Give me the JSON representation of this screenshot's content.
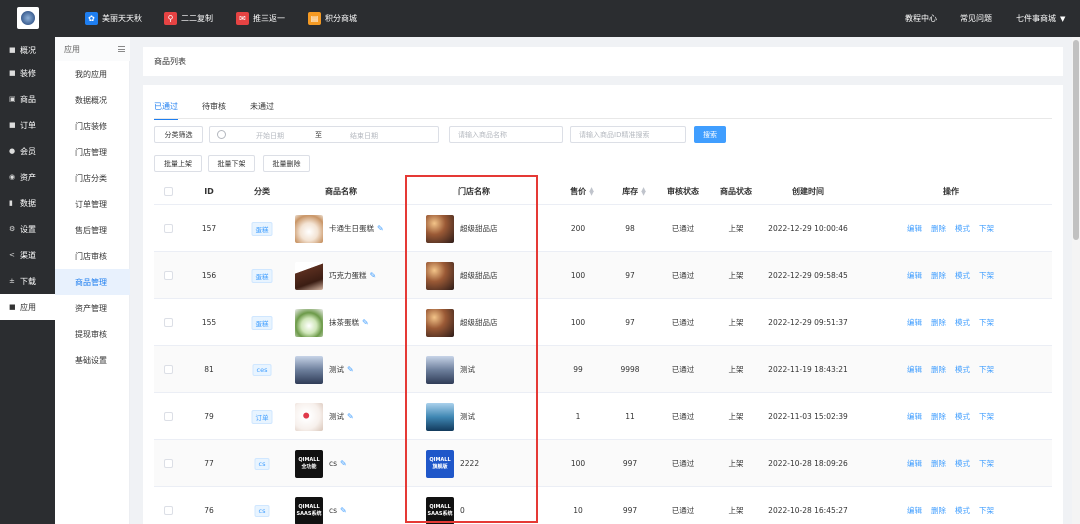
{
  "topbar": {
    "links": [
      {
        "label": "美丽天天秋",
        "icon": "gift-icon",
        "color": "#1e7ef0"
      },
      {
        "label": "二二复制",
        "icon": "share-icon",
        "color": "#e64343"
      },
      {
        "label": "推三返一",
        "icon": "redpacket-icon",
        "color": "#e64343"
      },
      {
        "label": "积分商城",
        "icon": "shop-icon",
        "color": "#f59a23"
      }
    ],
    "right": [
      "教程中心",
      "常见问题",
      "七件事商城"
    ]
  },
  "leftnav": [
    {
      "label": "概况",
      "icon": "square-icon"
    },
    {
      "label": "装修",
      "icon": "square-icon"
    },
    {
      "label": "商品",
      "icon": "cart-icon"
    },
    {
      "label": "订单",
      "icon": "order-icon"
    },
    {
      "label": "会员",
      "icon": "user-icon"
    },
    {
      "label": "资产",
      "icon": "asset-icon"
    },
    {
      "label": "数据",
      "icon": "chart-icon"
    },
    {
      "label": "设置",
      "icon": "gear-icon"
    },
    {
      "label": "渠道",
      "icon": "share-icon"
    },
    {
      "label": "下载",
      "icon": "download-icon"
    },
    {
      "label": "应用",
      "icon": "app-icon"
    }
  ],
  "subnav": {
    "title": "应用",
    "items": [
      "我的应用",
      "数据概况",
      "门店装修",
      "门店管理",
      "门店分类",
      "订单管理",
      "售后管理",
      "门店审核",
      "商品管理",
      "资产管理",
      "提现审核",
      "基础设置"
    ]
  },
  "breadcrumb": "商品列表",
  "tabs": [
    "已通过",
    "待审核",
    "未通过"
  ],
  "filters": {
    "category_btn": "分类筛选",
    "start_date": "开始日期",
    "to": "至",
    "end_date": "结束日期",
    "name_placeholder": "请输入商品名称",
    "id_placeholder": "请输入商品ID精准搜索",
    "search_btn": "搜索"
  },
  "batch": [
    "批量上架",
    "批量下架",
    "批量删除"
  ],
  "columns": {
    "id": "ID",
    "category": "分类",
    "name": "商品名称",
    "store": "门店名称",
    "price": "售价",
    "stock": "库存",
    "audit": "审核状态",
    "status": "商品状态",
    "created": "创建时间",
    "actions": "操作"
  },
  "actions": [
    "编辑",
    "删除",
    "模式",
    "下架"
  ],
  "rows": [
    {
      "id": "157",
      "category": "蛋糕",
      "name": "卡通生日蛋糕",
      "thumb": "cake",
      "store": "超级甜品店",
      "store_thumb": "store",
      "price": "200",
      "stock": "98",
      "audit": "已通过",
      "status": "上架",
      "created": "2022-12-29 10:00:46"
    },
    {
      "id": "156",
      "category": "蛋糕",
      "name": "巧克力蛋糕",
      "thumb": "choc",
      "store": "超级甜品店",
      "store_thumb": "store",
      "price": "100",
      "stock": "97",
      "audit": "已通过",
      "status": "上架",
      "created": "2022-12-29 09:58:45"
    },
    {
      "id": "155",
      "category": "蛋糕",
      "name": "抹茶蛋糕",
      "thumb": "matcha",
      "store": "超级甜品店",
      "store_thumb": "store",
      "price": "100",
      "stock": "97",
      "audit": "已通过",
      "status": "上架",
      "created": "2022-12-29 09:51:37"
    },
    {
      "id": "81",
      "category": "ces",
      "name": "测试",
      "thumb": "test",
      "store": "测试",
      "store_thumb": "test",
      "price": "99",
      "stock": "9998",
      "audit": "已通过",
      "status": "上架",
      "created": "2022-11-19 18:43:21"
    },
    {
      "id": "79",
      "category": "订单",
      "name": "测试",
      "thumb": "heart",
      "store": "测试",
      "store_thumb": "sea",
      "price": "1",
      "stock": "11",
      "audit": "已通过",
      "status": "上架",
      "created": "2022-11-03 15:02:39"
    },
    {
      "id": "77",
      "category": "cs",
      "name": "cs",
      "thumb": "qimall",
      "thumb_text": [
        "QIMALL",
        "全功能"
      ],
      "store": "2222",
      "store_thumb": "qblue",
      "store_thumb_text": [
        "QIMALL",
        "旗舰版"
      ],
      "price": "100",
      "stock": "997",
      "audit": "已通过",
      "status": "上架",
      "created": "2022-10-28 18:09:26"
    },
    {
      "id": "76",
      "category": "cs",
      "name": "cs",
      "thumb": "qimall",
      "thumb_text": [
        "QIMALL",
        "SAAS系统"
      ],
      "store": "0",
      "store_thumb": "qimall",
      "store_thumb_text": [
        "QIMALL",
        "SAAS系统"
      ],
      "price": "10",
      "stock": "997",
      "audit": "已通过",
      "status": "上架",
      "created": "2022-10-28 16:45:27"
    }
  ]
}
